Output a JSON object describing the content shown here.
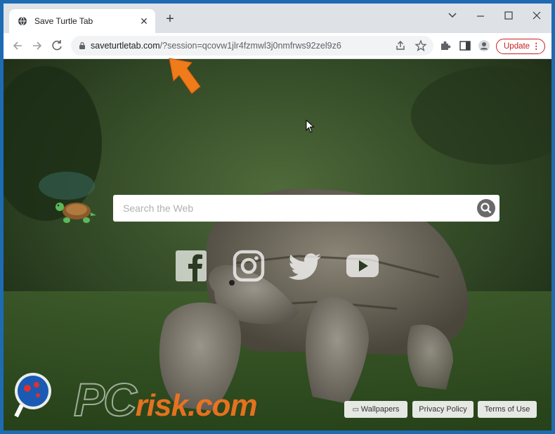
{
  "browser": {
    "tab_title": "Save Turtle Tab",
    "url_host": "saveturtletab.com",
    "url_rest": "/?session=qcovw1jlr4fzmwl3j0nmfrws92zel9z6",
    "update_label": "Update"
  },
  "page": {
    "search_placeholder": "Search the Web",
    "social": [
      "facebook-icon",
      "instagram-icon",
      "twitter-icon",
      "youtube-icon"
    ],
    "footer": {
      "wallpapers": "Wallpapers",
      "privacy": "Privacy Policy",
      "terms": "Terms of Use"
    }
  },
  "watermark": {
    "pc": "PC",
    "risk": "risk.com"
  },
  "colors": {
    "update_red": "#c5221f",
    "arrow_orange": "#f07b1a",
    "watermark_orange": "#f5751f"
  }
}
